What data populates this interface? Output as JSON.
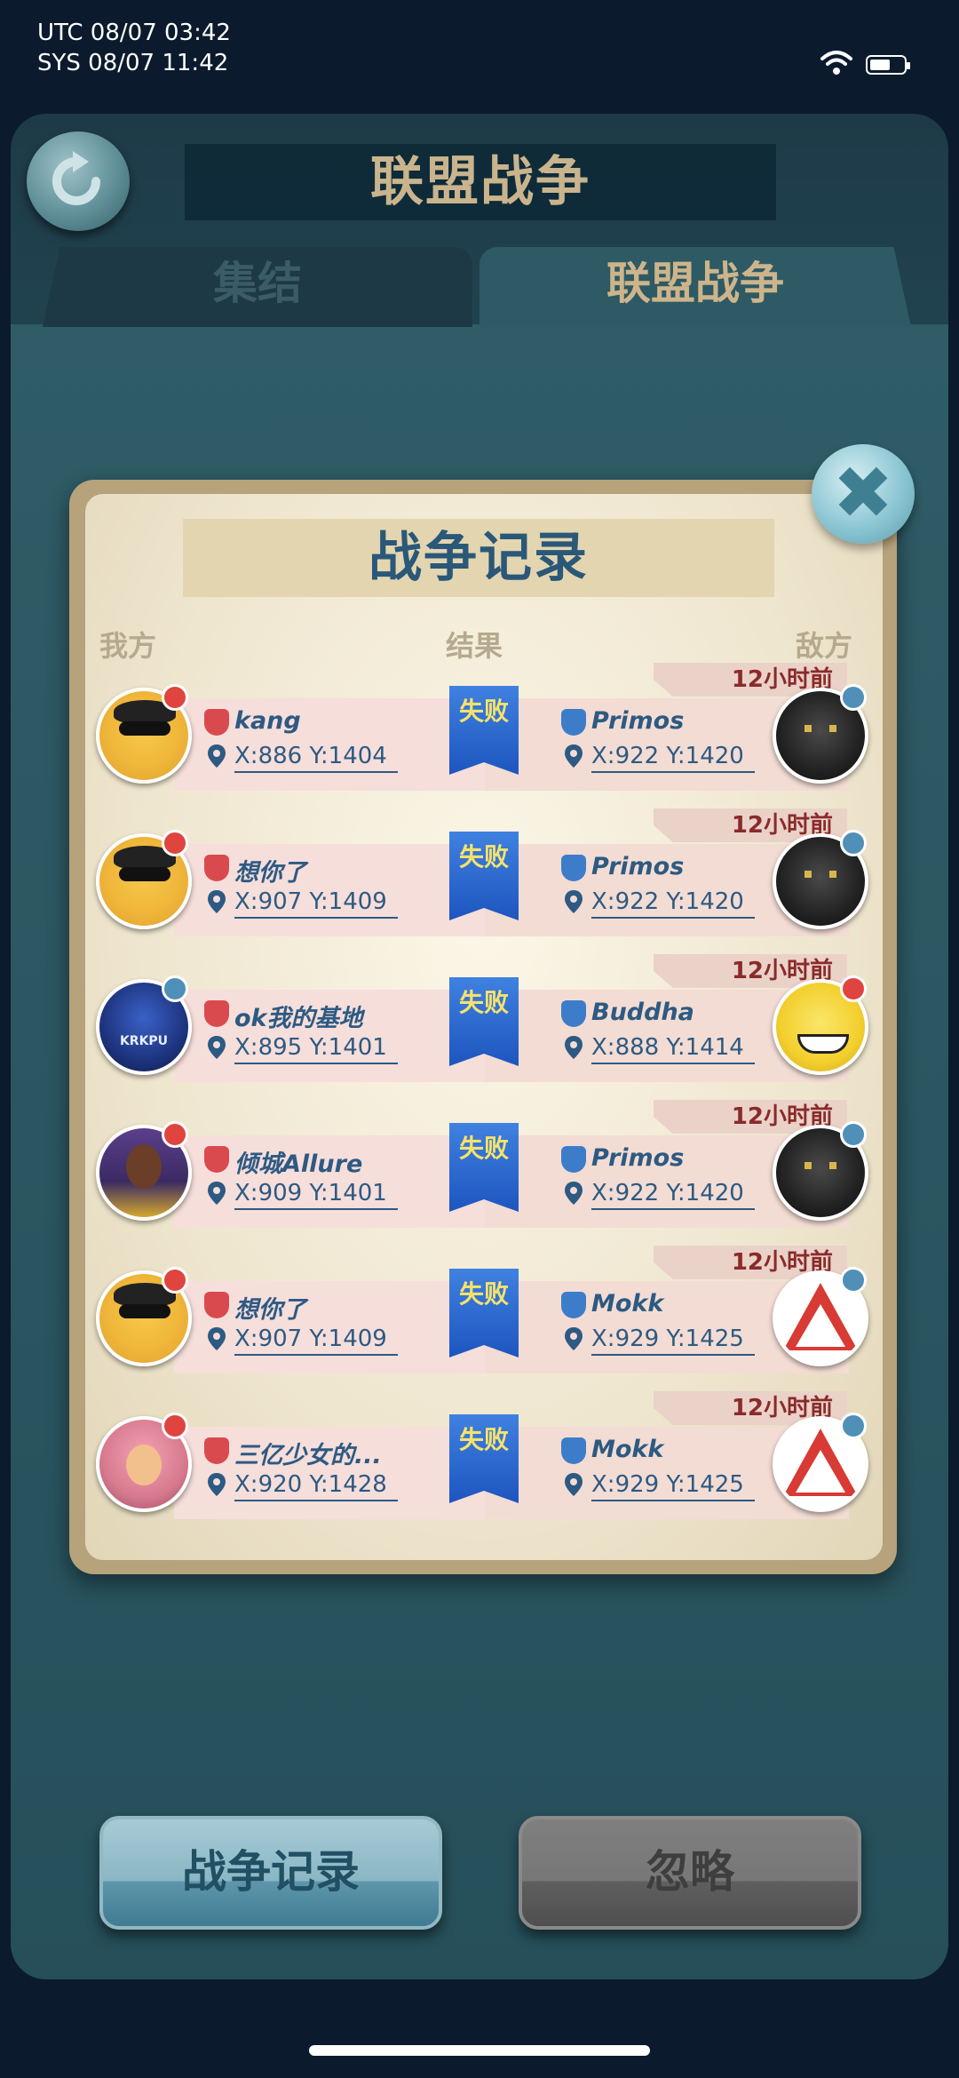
{
  "status_bar": {
    "utc": "UTC 08/07 03:42",
    "sys": "SYS 08/07 11:42"
  },
  "header": {
    "title": "联盟战争"
  },
  "tabs": [
    {
      "label": "集结",
      "active": false
    },
    {
      "label": "联盟战争",
      "active": true
    }
  ],
  "dialog": {
    "title": "战争记录",
    "col_mine": "我方",
    "col_result": "结果",
    "col_enemy": "敌方",
    "records": [
      {
        "time": "12小时前",
        "result": "失败",
        "my_name": "kang",
        "my_coord": "X:886 Y:1404",
        "enemy_name": "Primos",
        "enemy_coord": "X:922 Y:1420",
        "my_avatar": "sunglasses-man-avatar",
        "enemy_avatar": "black-lion-avatar"
      },
      {
        "time": "12小时前",
        "result": "失败",
        "my_name": "想你了",
        "my_coord": "X:907 Y:1409",
        "enemy_name": "Primos",
        "enemy_coord": "X:922 Y:1420",
        "my_avatar": "sunglasses-man-avatar",
        "enemy_avatar": "black-lion-avatar"
      },
      {
        "time": "12小时前",
        "result": "失败",
        "my_name": "ok我的基地",
        "my_coord": "X:895 Y:1401",
        "enemy_name": "Buddha",
        "enemy_coord": "X:888 Y:1414",
        "my_avatar": "krkpu-logo-avatar",
        "enemy_avatar": "yellow-grin-avatar"
      },
      {
        "time": "12小时前",
        "result": "失败",
        "my_name": "倾城Allure",
        "my_coord": "X:909 Y:1401",
        "enemy_name": "Primos",
        "enemy_coord": "X:922 Y:1420",
        "my_avatar": "basketball-player-avatar",
        "enemy_avatar": "black-lion-avatar"
      },
      {
        "time": "12小时前",
        "result": "失败",
        "my_name": "想你了",
        "my_coord": "X:907 Y:1409",
        "enemy_name": "Mokk",
        "enemy_coord": "X:929 Y:1425",
        "my_avatar": "sunglasses-man-avatar",
        "enemy_avatar": "road-work-sign-avatar"
      },
      {
        "time": "12小时前",
        "result": "失败",
        "my_name": "三亿少女的...",
        "my_coord": "X:920 Y:1428",
        "enemy_name": "Mokk",
        "enemy_coord": "X:929 Y:1425",
        "my_avatar": "pink-hero-avatar",
        "enemy_avatar": "road-work-sign-avatar"
      }
    ]
  },
  "buttons": {
    "records": "战争记录",
    "ignore": "忽略"
  },
  "colors": {
    "accent_gold": "#c9b48d",
    "link_blue": "#2d5a82",
    "result_blue": "#1d55bf",
    "time_red": "#8a2b2b"
  }
}
